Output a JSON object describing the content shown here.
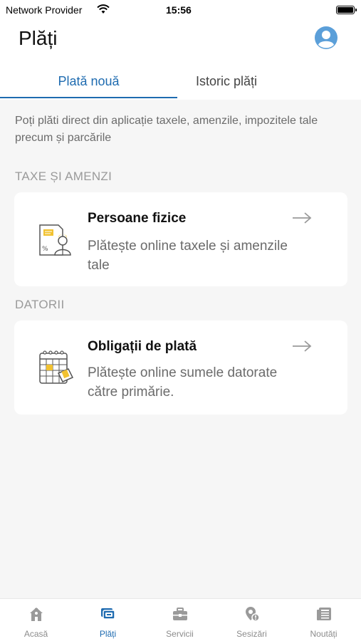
{
  "status_bar": {
    "carrier": "Network Provider",
    "time": "15:56"
  },
  "header": {
    "title": "Plăți",
    "avatar_icon": "user-circle-icon"
  },
  "tabs": [
    {
      "label": "Plată nouă",
      "active": true
    },
    {
      "label": "Istoric plăți",
      "active": false
    }
  ],
  "intro_text": "Poți plăti direct din aplicație taxele, amenzile, impozitele tale precum și parcările",
  "sections": [
    {
      "title": "TAXE ȘI AMENZI",
      "card": {
        "title": "Persoane fizice",
        "description": "Plătește online taxele și amenzile tale",
        "icon": "person-document-icon"
      }
    },
    {
      "title": "DATORII",
      "card": {
        "title": "Obligații de plată",
        "description": "Plătește online sumele datorate către primărie.",
        "icon": "calendar-payment-icon"
      }
    }
  ],
  "bottom_nav": [
    {
      "label": "Acasă",
      "icon": "home-icon",
      "active": false
    },
    {
      "label": "Plăți",
      "icon": "payments-icon",
      "active": true
    },
    {
      "label": "Servicii",
      "icon": "briefcase-icon",
      "active": false
    },
    {
      "label": "Sesizări",
      "icon": "location-alert-icon",
      "active": false
    },
    {
      "label": "Noutăți",
      "icon": "newspaper-icon",
      "active": false
    }
  ],
  "colors": {
    "accent": "#1e6bb0",
    "background": "#f6f6f6",
    "muted_text": "#6b6b6b",
    "icon_yellow": "#f2c230",
    "inactive_icon": "#9a9a9a"
  }
}
